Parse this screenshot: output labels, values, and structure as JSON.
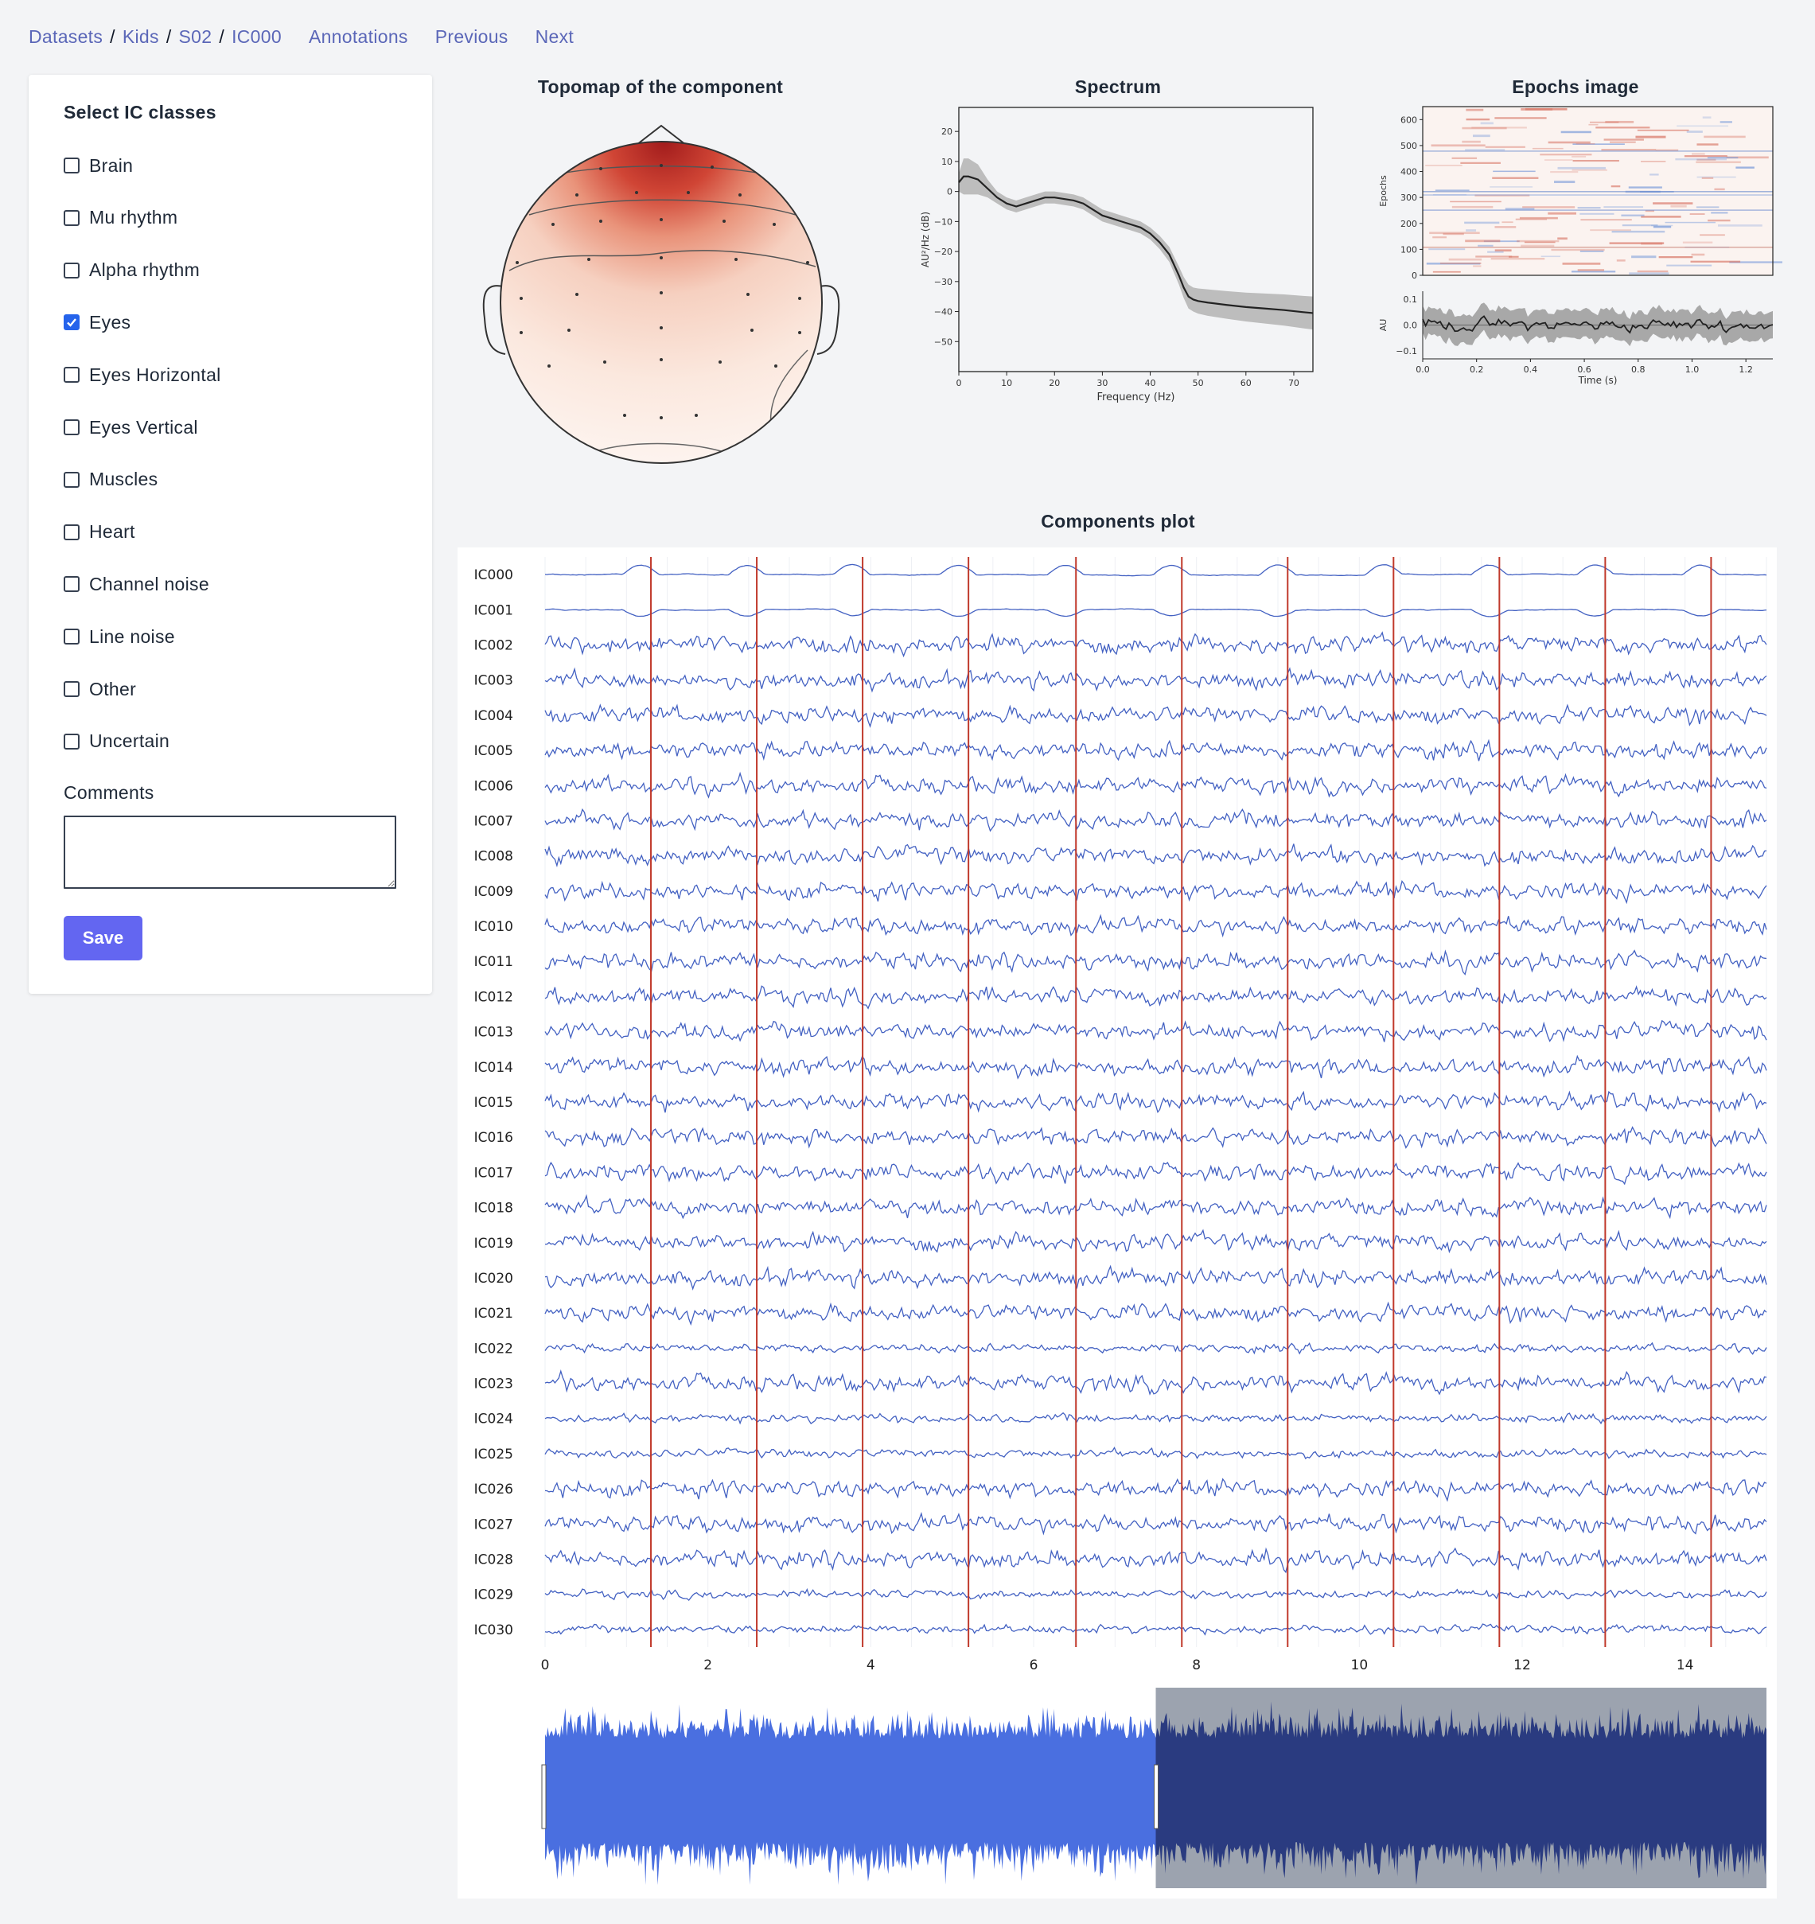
{
  "breadcrumb": {
    "items": [
      "Datasets",
      "Kids",
      "S02",
      "IC000"
    ],
    "separator": "/",
    "links": [
      "Annotations",
      "Previous",
      "Next"
    ]
  },
  "panel": {
    "title": "Select IC classes",
    "classes": [
      {
        "label": "Brain",
        "checked": false
      },
      {
        "label": "Mu rhythm",
        "checked": false
      },
      {
        "label": "Alpha rhythm",
        "checked": false
      },
      {
        "label": "Eyes",
        "checked": true
      },
      {
        "label": "Eyes Horizontal",
        "checked": false
      },
      {
        "label": "Eyes Vertical",
        "checked": false
      },
      {
        "label": "Muscles",
        "checked": false
      },
      {
        "label": "Heart",
        "checked": false
      },
      {
        "label": "Channel noise",
        "checked": false
      },
      {
        "label": "Line noise",
        "checked": false
      },
      {
        "label": "Other",
        "checked": false
      },
      {
        "label": "Uncertain",
        "checked": false
      }
    ],
    "comments_label": "Comments",
    "comments_value": "",
    "save_label": "Save"
  },
  "plots": {
    "topomap_title": "Topomap of the component",
    "spectrum_title": "Spectrum",
    "epochs_title": "Epochs image",
    "components_title": "Components plot"
  },
  "colors": {
    "link": "#5b67b8",
    "accent_button": "#6366f1",
    "checkbox_checked": "#2563eb",
    "trace": "#4361c2",
    "event_marker": "#c0392b",
    "range_selected": "#4a6fe0",
    "range_unselected": "#2a3b80",
    "range_shade": "#9ca3af"
  },
  "chart_data": [
    {
      "type": "line",
      "title": "Spectrum",
      "xlabel": "Frequency (Hz)",
      "ylabel": "AU²/Hz (dB)",
      "xlim": [
        0,
        74
      ],
      "ylim": [
        -60,
        28
      ],
      "xticks": [
        0,
        10,
        20,
        30,
        40,
        50,
        60,
        70
      ],
      "yticks": [
        20,
        10,
        0,
        -10,
        -20,
        -30,
        -40,
        -50
      ],
      "series": [
        {
          "x": [
            0,
            1,
            2,
            4,
            6,
            8,
            10,
            12,
            14,
            16,
            18,
            20,
            22,
            24,
            26,
            28,
            30,
            32,
            34,
            36,
            38,
            40,
            42,
            44,
            46,
            47,
            48,
            49,
            50,
            52,
            56,
            60,
            64,
            68,
            72,
            74
          ],
          "values": [
            3,
            5,
            5,
            4,
            1,
            -2,
            -4,
            -5,
            -4,
            -3,
            -2,
            -2,
            -2.5,
            -3,
            -4,
            -6,
            -8,
            -9,
            -10,
            -11,
            -12,
            -14,
            -17,
            -21,
            -28,
            -32,
            -35,
            -36,
            -36.5,
            -37,
            -37.8,
            -38.5,
            -39,
            -39.5,
            -40.2,
            -40.5
          ],
          "band_halfwidth": [
            3,
            6,
            6,
            5,
            3,
            2,
            2,
            2,
            2,
            2,
            2,
            2,
            2,
            2,
            2,
            2,
            2,
            2,
            2,
            2,
            2,
            2,
            2.2,
            2.5,
            3,
            3.5,
            4,
            4,
            4.2,
            4.4,
            4.6,
            4.8,
            5,
            5.2,
            5.4,
            5.5
          ]
        }
      ]
    },
    {
      "type": "heatmap",
      "title": "Epochs image",
      "ylabel": "Epochs",
      "ylim": [
        0,
        650
      ],
      "yticks": [
        0,
        100,
        200,
        300,
        400,
        500,
        600
      ]
    },
    {
      "type": "line",
      "title": "Epochs image",
      "xlabel": "Time (s)",
      "ylabel": "AU",
      "xlim": [
        0,
        1.3
      ],
      "ylim": [
        -0.13,
        0.13
      ],
      "xticks": [
        0.0,
        0.2,
        0.4,
        0.6,
        0.8,
        1.0,
        1.2
      ],
      "yticks": [
        0.1,
        0.0,
        -0.1
      ]
    },
    {
      "type": "line",
      "title": "Components plot",
      "xlim": [
        0,
        15
      ],
      "xticks": [
        0,
        2,
        4,
        6,
        8,
        10,
        12,
        14
      ],
      "channels": [
        "IC000",
        "IC001",
        "IC002",
        "IC003",
        "IC004",
        "IC005",
        "IC006",
        "IC007",
        "IC008",
        "IC009",
        "IC010",
        "IC011",
        "IC012",
        "IC013",
        "IC014",
        "IC015",
        "IC016",
        "IC017",
        "IC018",
        "IC019",
        "IC020",
        "IC021",
        "IC022",
        "IC023",
        "IC024",
        "IC025",
        "IC026",
        "IC027",
        "IC028",
        "IC029",
        "IC030"
      ],
      "event_markers_s": [
        1.3,
        2.6,
        3.9,
        5.2,
        6.52,
        7.82,
        9.12,
        10.42,
        11.72,
        13.02,
        14.32
      ],
      "range_slider": {
        "selected_fraction": [
          0.0,
          0.5
        ]
      }
    }
  ]
}
